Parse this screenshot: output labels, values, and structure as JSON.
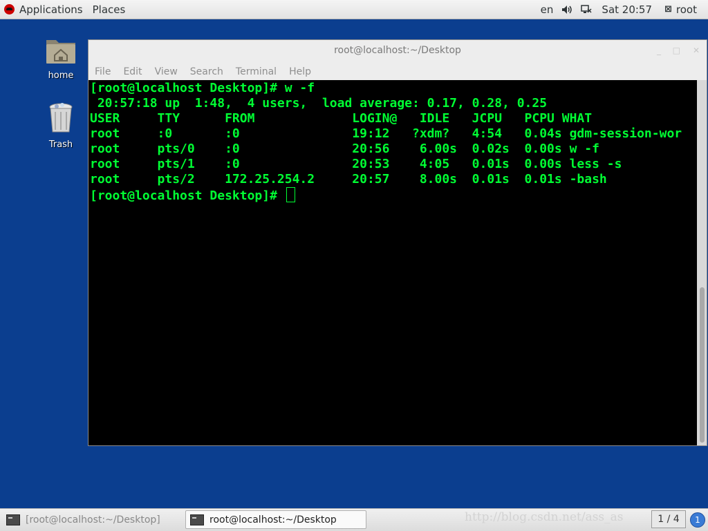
{
  "top_panel": {
    "applications_label": "Applications",
    "places_label": "Places",
    "language": "en",
    "clock": "Sat 20:57",
    "user": "root"
  },
  "desktop": {
    "icons": [
      {
        "label": "home"
      },
      {
        "label": "Trash"
      }
    ]
  },
  "window": {
    "title": "root@localhost:~/Desktop",
    "menu": [
      "File",
      "Edit",
      "View",
      "Search",
      "Terminal",
      "Help"
    ]
  },
  "terminal": {
    "lines": [
      "[root@localhost Desktop]# w -f",
      " 20:57:18 up  1:48,  4 users,  load average: 0.17, 0.28, 0.25",
      "USER     TTY      FROM             LOGIN@   IDLE   JCPU   PCPU WHAT",
      "root     :0       :0               19:12   ?xdm?   4:54   0.04s gdm-session-wor",
      "root     pts/0    :0               20:56    6.00s  0.02s  0.00s w -f",
      "root     pts/1    :0               20:53    4:05   0.01s  0.00s less -s",
      "root     pts/2    172.25.254.2     20:57    8.00s  0.01s  0.01s -bash"
    ],
    "prompt": "[root@localhost Desktop]# "
  },
  "taskbar": {
    "tasks": [
      {
        "label": "[root@localhost:~/Desktop]"
      },
      {
        "label": "root@localhost:~/Desktop"
      }
    ],
    "watermark": "http://blog.csdn.net/ass_as",
    "workspace": "1 / 4",
    "notification_count": "1"
  }
}
